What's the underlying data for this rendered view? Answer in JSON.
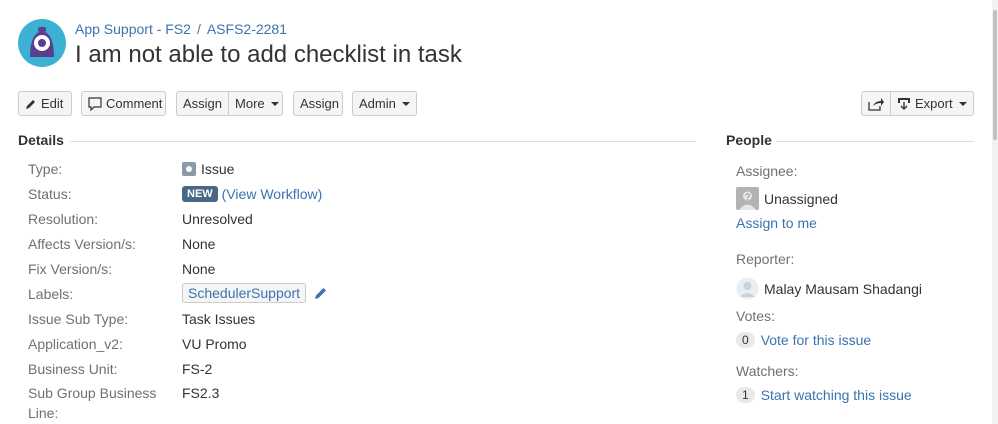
{
  "header": {
    "project_link": "App Support - FS2",
    "separator": "/",
    "issue_key": "ASFS2-2281",
    "title": "I am not able to add checklist in task"
  },
  "toolbar": {
    "edit": "Edit",
    "comment": "Comment",
    "assign": "Assign",
    "more": "More",
    "assign2": "Assign",
    "admin": "Admin",
    "export": "Export"
  },
  "details": {
    "heading": "Details",
    "rows": [
      {
        "label": "Type:",
        "value": "Issue"
      },
      {
        "label": "Status:",
        "value": "NEW",
        "extra": "(View Workflow)"
      },
      {
        "label": "Resolution:",
        "value": "Unresolved"
      },
      {
        "label": "Affects Version/s:",
        "value": "None"
      },
      {
        "label": "Fix Version/s:",
        "value": "None"
      },
      {
        "label": "Labels:",
        "value": "SchedulerSupport"
      },
      {
        "label": "Issue Sub Type:",
        "value": "Task Issues"
      },
      {
        "label": "Application_v2:",
        "value": "VU Promo"
      },
      {
        "label": "Business Unit:",
        "value": "FS-2"
      },
      {
        "label": "Sub Group Business",
        "label2": "Line:",
        "value": "FS2.3"
      }
    ]
  },
  "people": {
    "heading": "People",
    "assignee_label": "Assignee:",
    "assignee_value": "Unassigned",
    "assign_to_me": "Assign to me",
    "reporter_label": "Reporter:",
    "reporter_value": "Malay Mausam Shadangi",
    "votes_label": "Votes:",
    "votes_count": "0",
    "vote_link": "Vote for this issue",
    "watchers_label": "Watchers:",
    "watchers_count": "1",
    "watch_link": "Start watching this issue"
  },
  "colors": {
    "link": "#3b73af",
    "status_new": "#4a6785"
  }
}
